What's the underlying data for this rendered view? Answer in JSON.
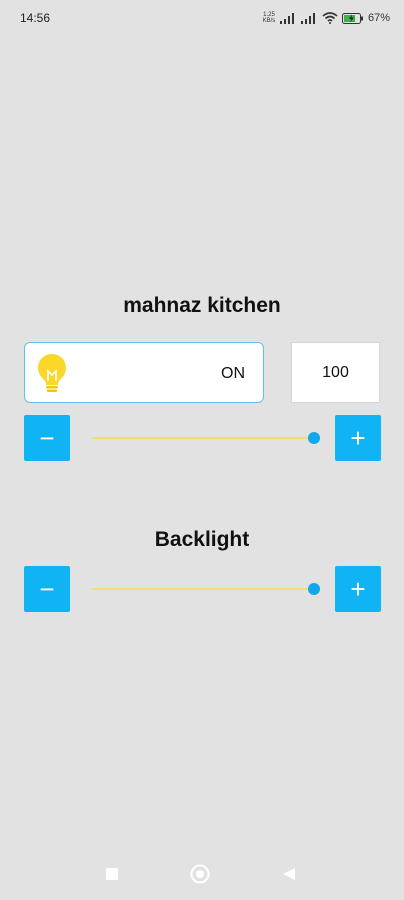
{
  "status_bar": {
    "time": "14:56",
    "net_speed_value": "1.25",
    "net_speed_unit": "KB/s",
    "battery_percent": "67"
  },
  "light": {
    "title": "mahnaz kitchen",
    "state": "ON",
    "level": "100",
    "slider_level_percent": 100,
    "decrease_label": "−",
    "increase_label": "+"
  },
  "backlight": {
    "title": "Backlight",
    "slider_level_percent": 100,
    "decrease_label": "−",
    "increase_label": "+"
  },
  "icons": {
    "bulb": "lightbulb-icon",
    "signal": "signal-icon",
    "wifi": "wifi-icon",
    "battery": "battery-charging-icon",
    "nav_recents": "square-icon",
    "nav_home": "circle-icon",
    "nav_back": "triangle-back-icon"
  },
  "colors": {
    "accent": "#10b3f4",
    "track": "#f2de6b",
    "bulb": "#fbd72b",
    "background": "#e2e2e2"
  }
}
